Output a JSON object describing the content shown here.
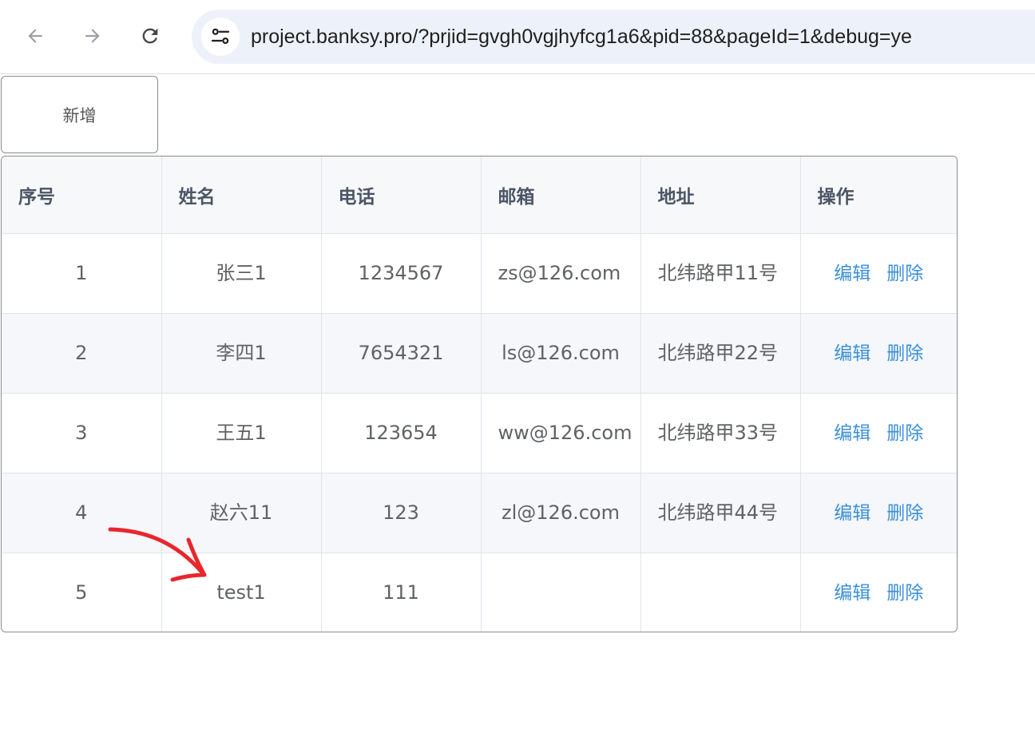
{
  "browser": {
    "url": "project.banksy.pro/?prjid=gvgh0vgjhyfcg1a6&pid=88&pageId=1&debug=ye"
  },
  "toolbar": {
    "add_label": "新增"
  },
  "table": {
    "headers": [
      "序号",
      "姓名",
      "电话",
      "邮箱",
      "地址",
      "操作"
    ],
    "rows": [
      {
        "index": "1",
        "name": "张三1",
        "phone": "1234567",
        "email": "zs@126.com",
        "address": "北纬路甲11号"
      },
      {
        "index": "2",
        "name": "李四1",
        "phone": "7654321",
        "email": "ls@126.com",
        "address": "北纬路甲22号"
      },
      {
        "index": "3",
        "name": "王五1",
        "phone": "123654",
        "email": "ww@126.com",
        "address": "北纬路甲33号"
      },
      {
        "index": "4",
        "name": "赵六11",
        "phone": "123",
        "email": "zl@126.com",
        "address": "北纬路甲44号"
      },
      {
        "index": "5",
        "name": "test1",
        "phone": "111",
        "email": "",
        "address": ""
      }
    ],
    "edit_label": "编辑",
    "delete_label": "删除"
  },
  "colors": {
    "link": "#3b8fd9",
    "annotation_arrow": "#e8262c",
    "header_bg": "#f7f8f9",
    "stripe_bg": "#f5f7fa"
  }
}
